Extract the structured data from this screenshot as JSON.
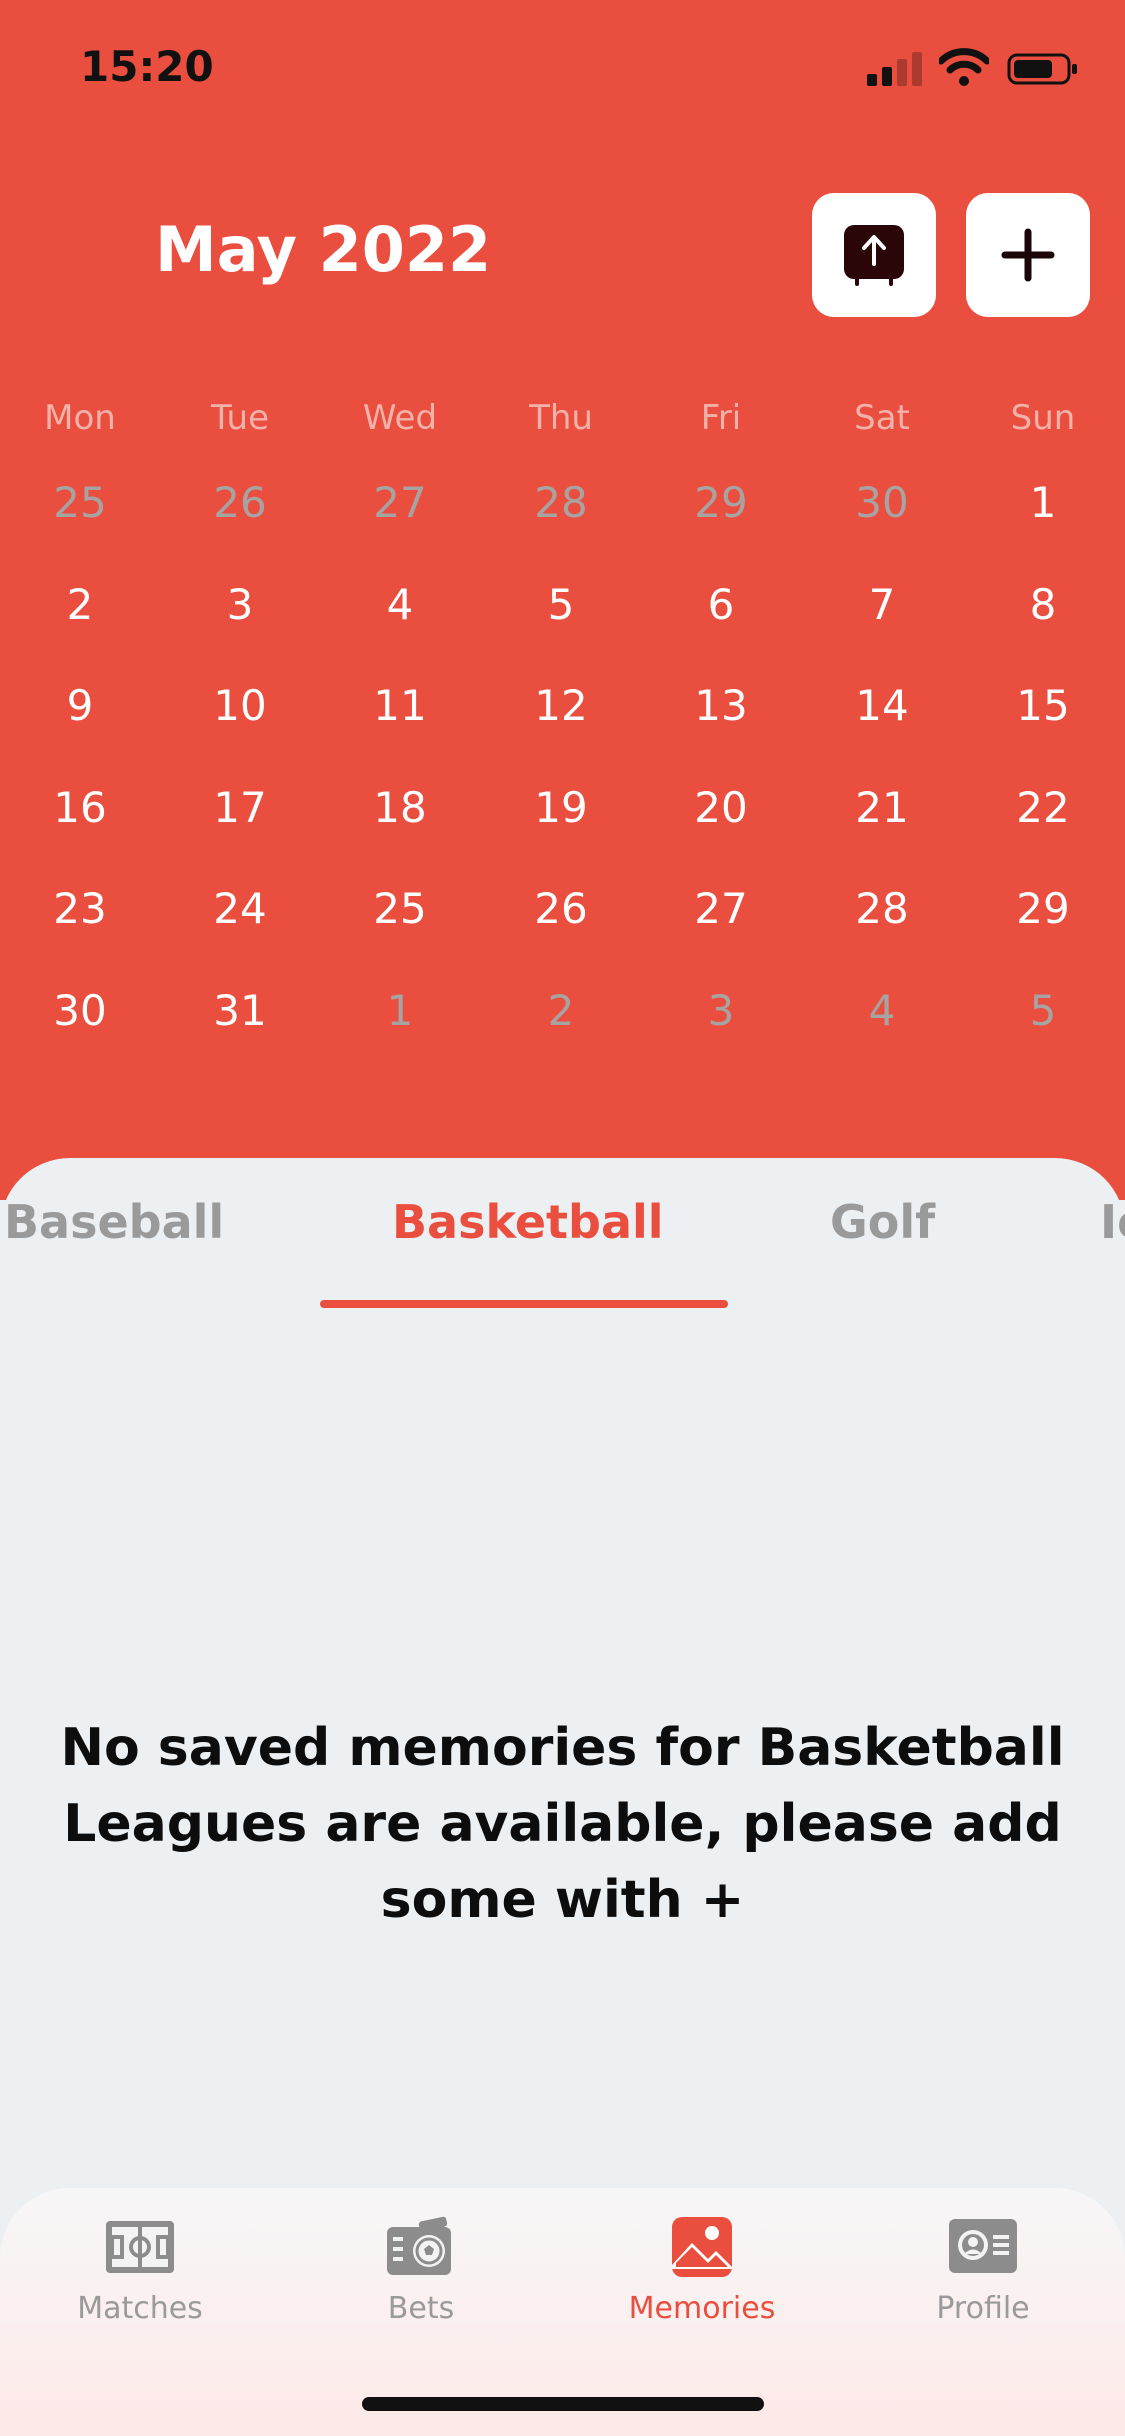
{
  "status": {
    "time": "15:20"
  },
  "header": {
    "month_title": "May 2022",
    "upload_icon": "upload-icon",
    "add_icon": "plus-icon"
  },
  "calendar": {
    "weekdays": [
      "Mon",
      "Tue",
      "Wed",
      "Thu",
      "Fri",
      "Sat",
      "Sun"
    ],
    "weeks": [
      [
        {
          "d": "25",
          "m": true
        },
        {
          "d": "26",
          "m": true
        },
        {
          "d": "27",
          "m": true
        },
        {
          "d": "28",
          "m": true
        },
        {
          "d": "29",
          "m": true
        },
        {
          "d": "30",
          "m": true
        },
        {
          "d": "1",
          "m": false
        }
      ],
      [
        {
          "d": "2",
          "m": false
        },
        {
          "d": "3",
          "m": false
        },
        {
          "d": "4",
          "m": false
        },
        {
          "d": "5",
          "m": false
        },
        {
          "d": "6",
          "m": false
        },
        {
          "d": "7",
          "m": false
        },
        {
          "d": "8",
          "m": false
        }
      ],
      [
        {
          "d": "9",
          "m": false
        },
        {
          "d": "10",
          "m": false
        },
        {
          "d": "11",
          "m": false
        },
        {
          "d": "12",
          "m": false
        },
        {
          "d": "13",
          "m": false
        },
        {
          "d": "14",
          "m": false
        },
        {
          "d": "15",
          "m": false
        }
      ],
      [
        {
          "d": "16",
          "m": false
        },
        {
          "d": "17",
          "m": false
        },
        {
          "d": "18",
          "m": false
        },
        {
          "d": "19",
          "m": false
        },
        {
          "d": "20",
          "m": false
        },
        {
          "d": "21",
          "m": false
        },
        {
          "d": "22",
          "m": false
        }
      ],
      [
        {
          "d": "23",
          "m": false
        },
        {
          "d": "24",
          "m": false
        },
        {
          "d": "25",
          "m": false
        },
        {
          "d": "26",
          "m": false
        },
        {
          "d": "27",
          "m": false
        },
        {
          "d": "28",
          "m": false
        },
        {
          "d": "29",
          "m": false
        }
      ],
      [
        {
          "d": "30",
          "m": false
        },
        {
          "d": "31",
          "m": false
        },
        {
          "d": "1",
          "m": true
        },
        {
          "d": "2",
          "m": true
        },
        {
          "d": "3",
          "m": true
        },
        {
          "d": "4",
          "m": true
        },
        {
          "d": "5",
          "m": true
        }
      ]
    ]
  },
  "sport_tabs": {
    "items": [
      "Baseball",
      "Basketball",
      "Golf",
      "Ic"
    ],
    "active": "Basketball"
  },
  "empty_state": {
    "message": "No saved memories for Basketball Leagues are available, please add some with +"
  },
  "tabbar": {
    "items": [
      {
        "label": "Matches",
        "icon": "field-icon"
      },
      {
        "label": "Bets",
        "icon": "ticket-ball-icon"
      },
      {
        "label": "Memories",
        "icon": "photo-icon"
      },
      {
        "label": "Profile",
        "icon": "id-card-icon"
      }
    ],
    "active": "Memories"
  },
  "colors": {
    "accent": "#e94e3f",
    "muted_text": "#9a9a9a",
    "background": "#ecf0f3"
  }
}
